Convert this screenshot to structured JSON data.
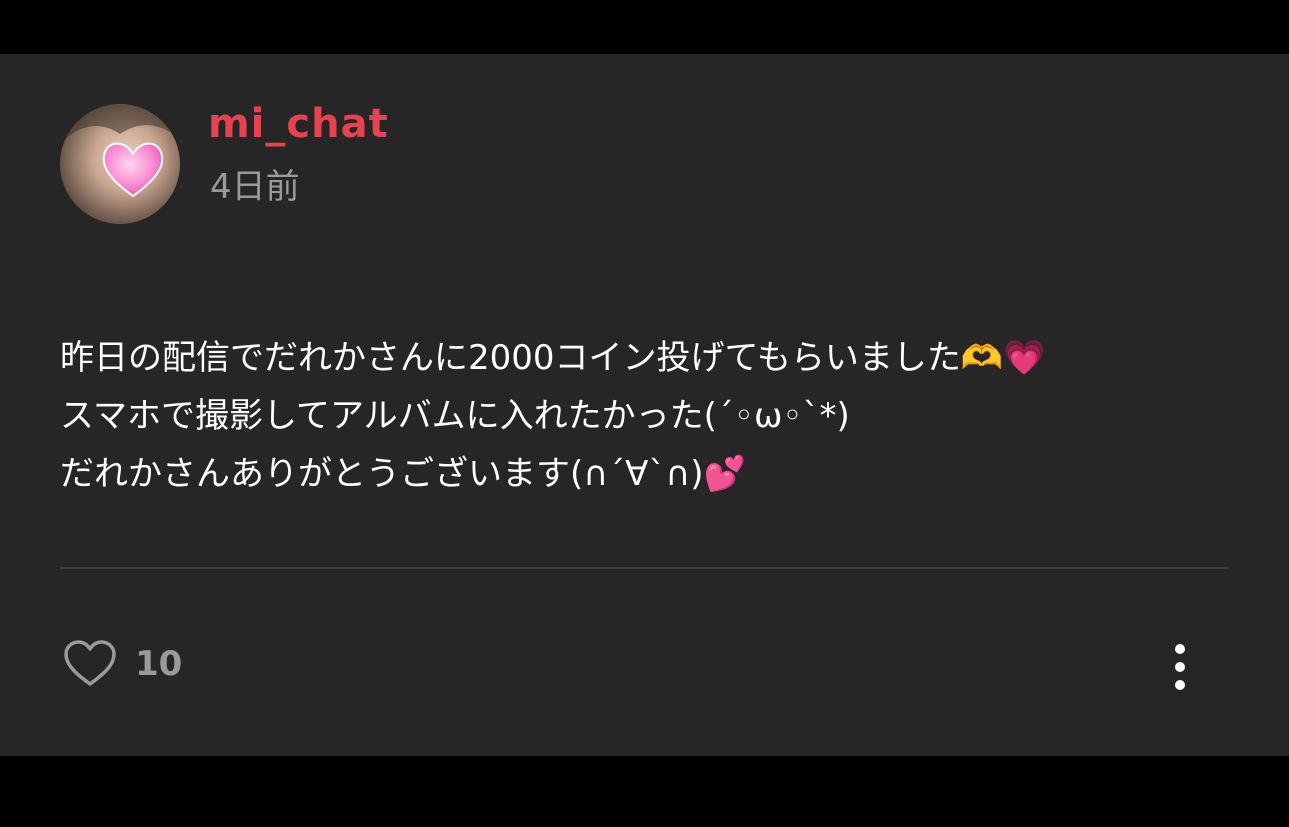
{
  "post": {
    "username": "mi_chat",
    "timestamp": "4日前",
    "body_lines": [
      "昨日の配信でだれかさんに2000コイン投げてもらいました🫶💗",
      "スマホで撮影してアルバムに入れたかった(´◦ω◦`*)",
      "だれかさんありがとうございます(∩´∀`∩)💕"
    ],
    "avatar_icon": "user-avatar",
    "like_icon": "heart-outline-icon",
    "like_count": "10",
    "more_icon": "more-vertical-icon"
  },
  "colors": {
    "background": "#000000",
    "card": "#262626",
    "username": "#e8414f",
    "muted": "#9a9a9a",
    "text": "#ffffff"
  }
}
